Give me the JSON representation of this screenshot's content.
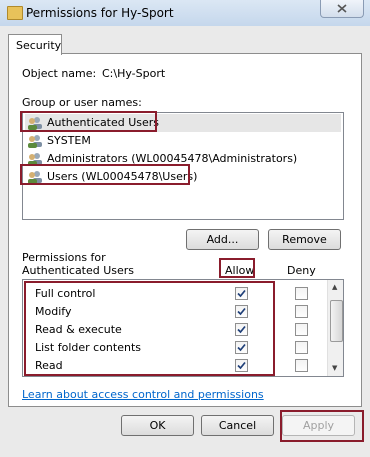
{
  "window": {
    "title": "Permissions for Hy-Sport"
  },
  "tabs": [
    {
      "label": "Security"
    }
  ],
  "object": {
    "label": "Object name:",
    "value": "C:\\Hy-Sport"
  },
  "groups": {
    "label": "Group or user names:",
    "items": [
      {
        "label": "Authenticated Users",
        "icon": "users-icon",
        "selected": true
      },
      {
        "label": "SYSTEM",
        "icon": "users-icon"
      },
      {
        "label": "Administrators (WL00045478\\Administrators)",
        "icon": "users-icon"
      },
      {
        "label": "Users (WL00045478\\Users)",
        "icon": "users-icon"
      }
    ]
  },
  "buttons": {
    "add": "Add...",
    "remove": "Remove",
    "ok": "OK",
    "cancel": "Cancel",
    "apply": "Apply"
  },
  "permissions": {
    "label": "Permissions for Authenticated Users",
    "allow_header": "Allow",
    "deny_header": "Deny",
    "rows": [
      {
        "name": "Full control",
        "allow": true,
        "deny": false
      },
      {
        "name": "Modify",
        "allow": true,
        "deny": false
      },
      {
        "name": "Read & execute",
        "allow": true,
        "deny": false
      },
      {
        "name": "List folder contents",
        "allow": true,
        "deny": false
      },
      {
        "name": "Read",
        "allow": true,
        "deny": false
      }
    ]
  },
  "link": {
    "text": "Learn about access control and permissions"
  },
  "colors": {
    "highlight_border": "#8a1c2c",
    "link": "#0066cc"
  }
}
